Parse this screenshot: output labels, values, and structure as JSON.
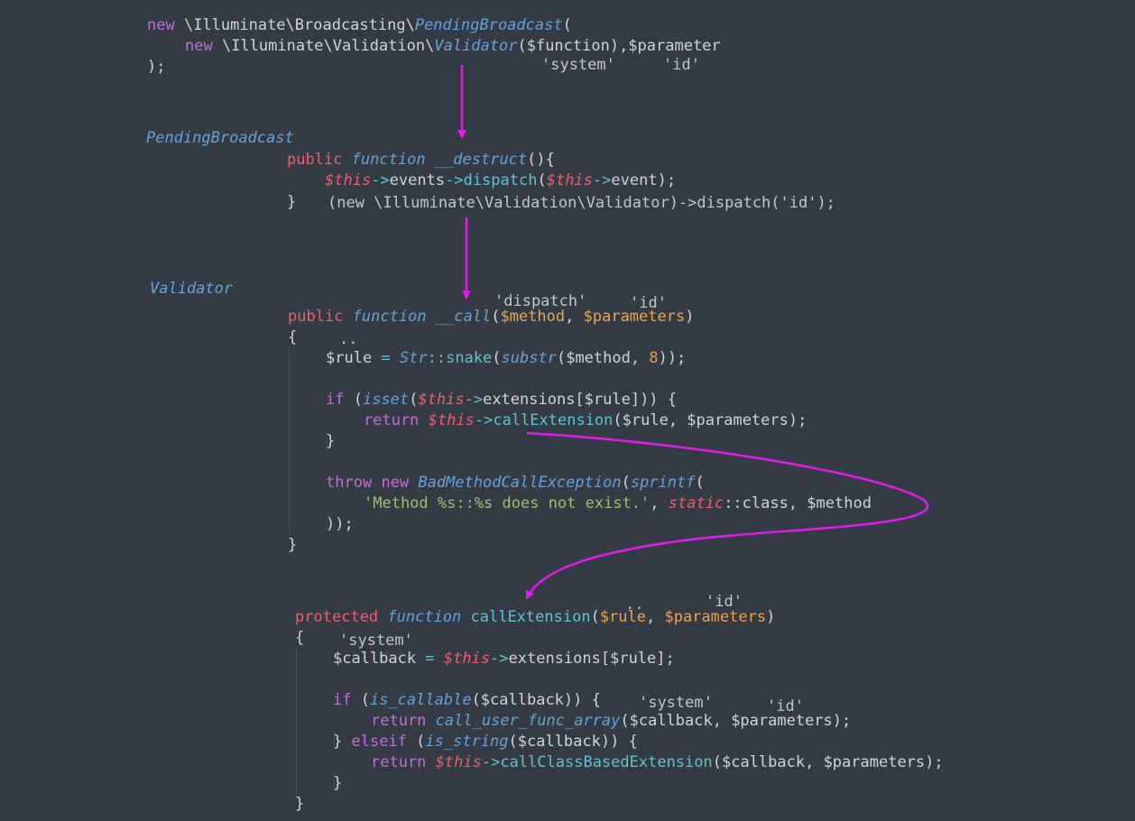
{
  "code": {
    "top": {
      "l1_new": "new",
      "l1_ns": " \\Illuminate\\Broadcasting\\",
      "l1_cls": "PendingBroadcast",
      "l1_open": "(",
      "l2_new": "new",
      "l2_ns": " \\Illuminate\\Validation\\",
      "l2_cls": "Validator",
      "l2_args": "($function),$parameter",
      "l3": ");"
    },
    "pending": {
      "label": "PendingBroadcast",
      "sig_public": "public",
      "sig_function": "function",
      "sig_name": "__destruct",
      "sig_rest": "(){",
      "body_this1": "$this",
      "body_arrow1": "->",
      "body_events": "events",
      "body_arrow2": "->",
      "body_dispatch": "dispatch",
      "body_open": "(",
      "body_this2": "$this",
      "body_arrow3": "->",
      "body_event": "event",
      "body_close": ");",
      "close_brace": "}",
      "resolved": "(new \\Illuminate\\Validation\\Validator)->dispatch('id');"
    },
    "validator": {
      "label": "Validator",
      "sig_public": "public",
      "sig_function": "function",
      "sig_name": "__call",
      "sig_open": "(",
      "sig_p1": "$method",
      "sig_comma": ", ",
      "sig_p2": "$parameters",
      "sig_close": ")",
      "open_brace": "{",
      "rule_var": "$rule",
      "rule_eq": " = ",
      "rule_str": "Str",
      "rule_colons": "::",
      "rule_snake": "snake",
      "rule_open": "(",
      "rule_substr": "substr",
      "rule_args": "($method, ",
      "rule_num": "8",
      "rule_end": "));",
      "if_kw": "if",
      "if_open": " (",
      "if_isset": "isset",
      "if_paren": "(",
      "if_this": "$this",
      "if_arrow": "->",
      "if_rest": "extensions[$rule])) {",
      "ret_kw": "return",
      "ret_this": "$this",
      "ret_arrow": "->",
      "ret_call": "callExtension",
      "ret_args": "($rule, $parameters);",
      "if_close": "}",
      "throw_kw": "throw",
      "throw_new": "new",
      "throw_cls": "BadMethodCallException",
      "throw_open": "(",
      "throw_sprintf": "sprintf",
      "throw_paren": "(",
      "msg_str": "'Method %s::%s does not exist.'",
      "msg_comma": ", ",
      "msg_static": "static",
      "msg_rest": "::class, $method",
      "throw_close": "));",
      "close_brace": "}"
    },
    "callext": {
      "sig_protected": "protected",
      "sig_function": "function",
      "sig_name": "callExtension",
      "sig_open": "(",
      "sig_p1": "$rule",
      "sig_comma": ", ",
      "sig_p2": "$parameters",
      "sig_close": ")",
      "open_brace": "{",
      "cb_var": "$callback",
      "cb_eq": " = ",
      "cb_this": "$this",
      "cb_arrow": "->",
      "cb_rest": "extensions[$rule];",
      "if_kw": "if",
      "if_open": " (",
      "if_fn": "is_callable",
      "if_rest": "($callback)) {",
      "ret1_kw": "return",
      "ret1_fn": "call_user_func_array",
      "ret1_args": "($callback, $parameters);",
      "else_open": "} ",
      "else_kw": "elseif",
      "else_p": " (",
      "else_fn": "is_string",
      "else_rest": "($callback)) {",
      "ret2_kw": "return",
      "ret2_this": "$this",
      "ret2_arrow": "->",
      "ret2_fn": "callClassBasedExtension",
      "ret2_args": "($callback, $parameters);",
      "if_close": "}",
      "close_brace": "}"
    }
  },
  "annotations": {
    "top_system": "'system'",
    "top_id": "'id'",
    "call_dispatch": "'dispatch'",
    "call_id": "'id'",
    "call_dots": "..",
    "ext_dots": "..",
    "ext_id": "'id'",
    "ext_system": "'system'",
    "ext_system2": "'system'",
    "ext_id2": "'id'"
  },
  "colors": {
    "background": "#353b45",
    "keyword": "#c56bd8",
    "modifier": "#ed5d6f",
    "function_italic": "#61a4d8",
    "method": "#5ec4cf",
    "variable": "#efa24b",
    "string": "#99c176",
    "arrow": "#e11ce8"
  }
}
